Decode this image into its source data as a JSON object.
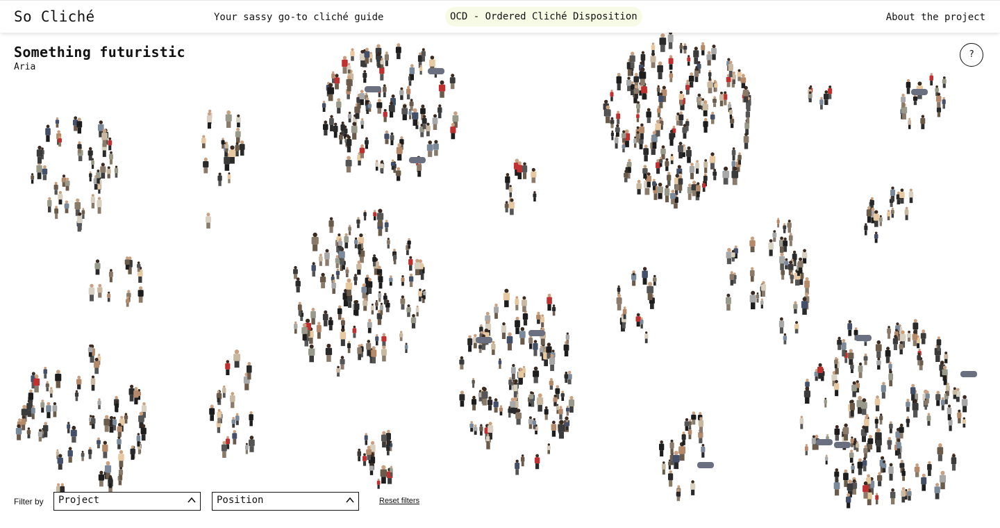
{
  "header": {
    "logo": "So Cliché",
    "tagline": "Your sassy go-to cliché guide",
    "ocd_label": "OCD - Ordered Cliché Disposition",
    "about_link": "About the project"
  },
  "page": {
    "title": "Something futuristic",
    "subtitle": "Aria",
    "help_label": "?"
  },
  "filters": {
    "label": "Filter by",
    "project_value": "Project",
    "position_value": "Position",
    "reset_label": "Reset filters"
  },
  "colors": {
    "text": "#111111",
    "ocd_highlight": "#f7fbe6",
    "background": "#ffffff"
  },
  "icons": {
    "help": "question-mark-icon",
    "dropdown": "chevron-up-icon"
  }
}
